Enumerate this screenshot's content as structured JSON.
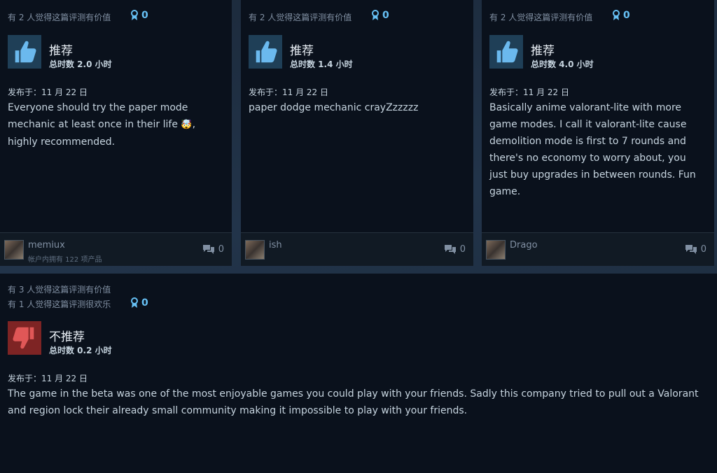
{
  "reviews": [
    {
      "helpful": "有 2 人觉得这篇评测有价值",
      "award_count": "0",
      "verdict": "推荐",
      "hours": "总时数 2.0 小时",
      "posted": "发布于：11 月 22 日",
      "text_before_emoji": "Everyone should try the paper mode mechanic at least once in their life ",
      "emoji": "🤯",
      "text_after_emoji": ", highly recommended.",
      "username": "memiux",
      "products_owned": "帐户内拥有 122 项产品",
      "comment_count": "0"
    },
    {
      "helpful": "有 2 人觉得这篇评测有价值",
      "award_count": "0",
      "verdict": "推荐",
      "hours": "总时数 1.4 小时",
      "posted": "发布于：11 月 22 日",
      "text": "paper dodge mechanic crayZzzzzz",
      "username": "ish",
      "comment_count": "0"
    },
    {
      "helpful": "有 2 人觉得这篇评测有价值",
      "award_count": "0",
      "verdict": "推荐",
      "hours": "总时数 4.0 小时",
      "posted": "发布于：11 月 22 日",
      "text": "Basically anime valorant-lite with more game modes. I call it valorant-lite cause demolition mode is first to 7 rounds and there's no economy to worry about, you just buy upgrades in between rounds. Fun game.",
      "username": "Drago",
      "comment_count": "0"
    },
    {
      "helpful": "有 3 人觉得这篇评测有价值",
      "funny": "有 1 人觉得这篇评测很欢乐",
      "award_count": "0",
      "verdict": "不推荐",
      "hours": "总时数 0.2 小时",
      "posted": "发布于：11 月 22 日",
      "text": "The game in the beta was one of the most enjoyable games you could play with your friends. Sadly this company tried to pull out a Valorant and region lock their already small community making it impossible to play with your friends."
    }
  ],
  "icons": {
    "award": "award-ribbon-icon",
    "thumbs_up": "thumbs-up-icon",
    "thumbs_down": "thumbs-down-icon",
    "comment": "comment-bubbles-icon"
  },
  "colors": {
    "card_bg": "#0a111c",
    "accent": "#66c0f4",
    "positive_bg": "#1f3f57",
    "negative_bg": "#7e2424",
    "text": "#c6d4df",
    "muted": "#8190a3"
  }
}
